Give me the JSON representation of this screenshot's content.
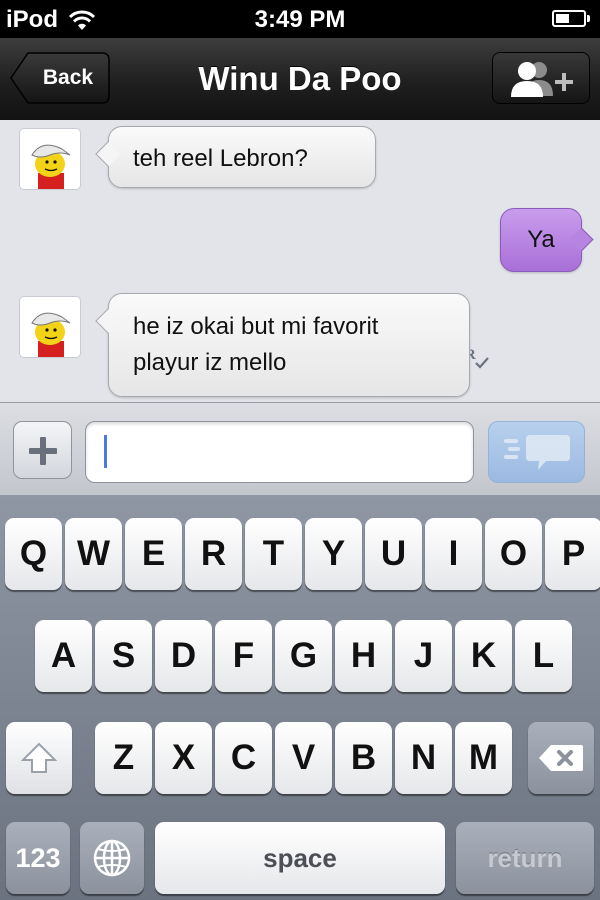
{
  "status_bar": {
    "carrier": "iPod",
    "time": "3:49 PM",
    "battery_level": 0.5
  },
  "nav": {
    "back_label": "Back",
    "title": "Winu Da Poo",
    "add_contact_icon": "add-person-icon"
  },
  "messages": [
    {
      "direction": "incoming",
      "text": "teh reel Lebron?"
    },
    {
      "direction": "outgoing",
      "text": "Ya",
      "receipt": "R"
    },
    {
      "direction": "incoming",
      "lines": [
        "he iz okai but mi favorit",
        "playur iz mello"
      ]
    }
  ],
  "composer": {
    "input_value": "",
    "plus_icon": "plus-icon",
    "send_icon": "send-icon"
  },
  "keyboard": {
    "row1": [
      "Q",
      "W",
      "E",
      "R",
      "T",
      "Y",
      "U",
      "I",
      "O",
      "P"
    ],
    "row2": [
      "A",
      "S",
      "D",
      "F",
      "G",
      "H",
      "J",
      "K",
      "L"
    ],
    "row3": [
      "Z",
      "X",
      "C",
      "V",
      "B",
      "N",
      "M"
    ],
    "numbers_label": "123",
    "space_label": "space",
    "return_label": "return"
  },
  "colors": {
    "outgoing_bubble": "#b784e1",
    "incoming_bubble": "#f2f2f2",
    "chat_background": "#e2e4ea",
    "keyboard_background": "#7d8591"
  }
}
